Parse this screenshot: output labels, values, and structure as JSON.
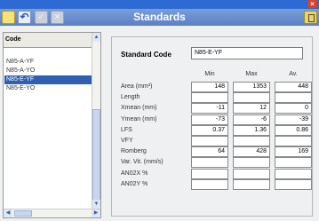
{
  "window": {
    "title": "Standards",
    "close_glyph": "×"
  },
  "toolbar": [
    "new-document-icon",
    "undo-icon",
    "check-icon",
    "delete-icon",
    "exit-door-icon"
  ],
  "list": {
    "header": "Code",
    "items": [
      {
        "label": "N85-A-YF",
        "selected": false
      },
      {
        "label": "N85-A-YO",
        "selected": false
      },
      {
        "label": "N85-E-YF",
        "selected": true
      },
      {
        "label": "N85-E-YO",
        "selected": false
      }
    ]
  },
  "form": {
    "standard_code_label": "Standard Code",
    "standard_code_value": "N85-E-YF",
    "columns": [
      "Min",
      "Max",
      "Av."
    ],
    "rows": [
      {
        "label": "Area (mm²)",
        "min": "148",
        "max": "1353",
        "av": "448"
      },
      {
        "label": "Length",
        "min": "",
        "max": "",
        "av": ""
      },
      {
        "label": "Xmean (mm)",
        "min": "-11",
        "max": "12",
        "av": "0"
      },
      {
        "label": "Ymean (mm)",
        "min": "-73",
        "max": "-6",
        "av": "-39"
      },
      {
        "label": "LFS",
        "min": "0.37",
        "max": "1.36",
        "av": "0.86"
      },
      {
        "label": "VFY",
        "min": "",
        "max": "",
        "av": ""
      },
      {
        "label": "Romberg",
        "min": "64",
        "max": "428",
        "av": "169"
      },
      {
        "label": "Var. Vit. (mm/s)",
        "min": "",
        "max": "",
        "av": ""
      },
      {
        "label": "AN02X %",
        "min": "",
        "max": "",
        "av": ""
      },
      {
        "label": "AN02Y %",
        "min": "",
        "max": "",
        "av": ""
      }
    ]
  }
}
